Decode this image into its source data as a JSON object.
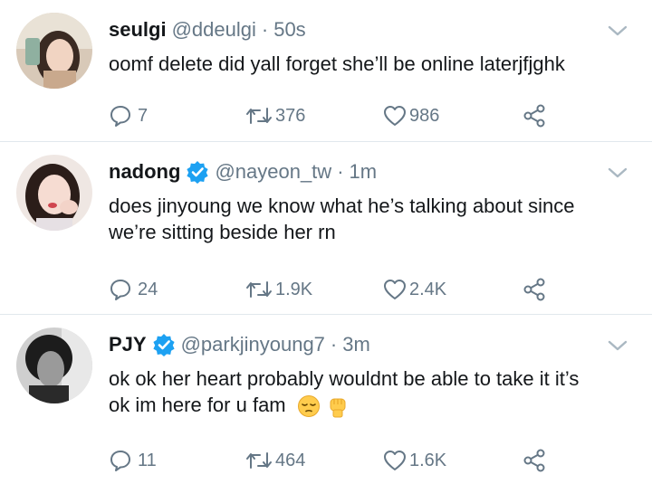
{
  "tweets": [
    {
      "name": "seulgi",
      "handle": "@ddeulgi",
      "time": "50s",
      "verified": false,
      "text_lines": [
        "oomf delete did yall forget she’ll be online laterjfjghk"
      ],
      "replies": "7",
      "retweets": "376",
      "likes": "986"
    },
    {
      "name": "nadong",
      "handle": "@nayeon_tw",
      "time": "1m",
      "verified": true,
      "text_lines": [
        "does jinyoung we know what he’s talking about since",
        "we’re sitting beside her rn"
      ],
      "replies": "24",
      "retweets": "1.9K",
      "likes": "2.4K"
    },
    {
      "name": "PJY",
      "handle": "@parkjinyoung7",
      "time": "3m",
      "verified": true,
      "text_lines": [
        "ok ok her heart probably wouldnt be able to take it it’s",
        "ok im here for u fam"
      ],
      "emojis": [
        "pensive-face",
        "raised-fist"
      ],
      "replies": "11",
      "retweets": "464",
      "likes": "1.6K"
    }
  ],
  "colors": {
    "verified": "#1da1f2",
    "secondary": "#657786",
    "divider": "#e1e8ed"
  },
  "icons": [
    "reply-icon",
    "retweet-icon",
    "like-icon",
    "share-icon",
    "chevron-down-icon",
    "verified-badge-icon"
  ]
}
